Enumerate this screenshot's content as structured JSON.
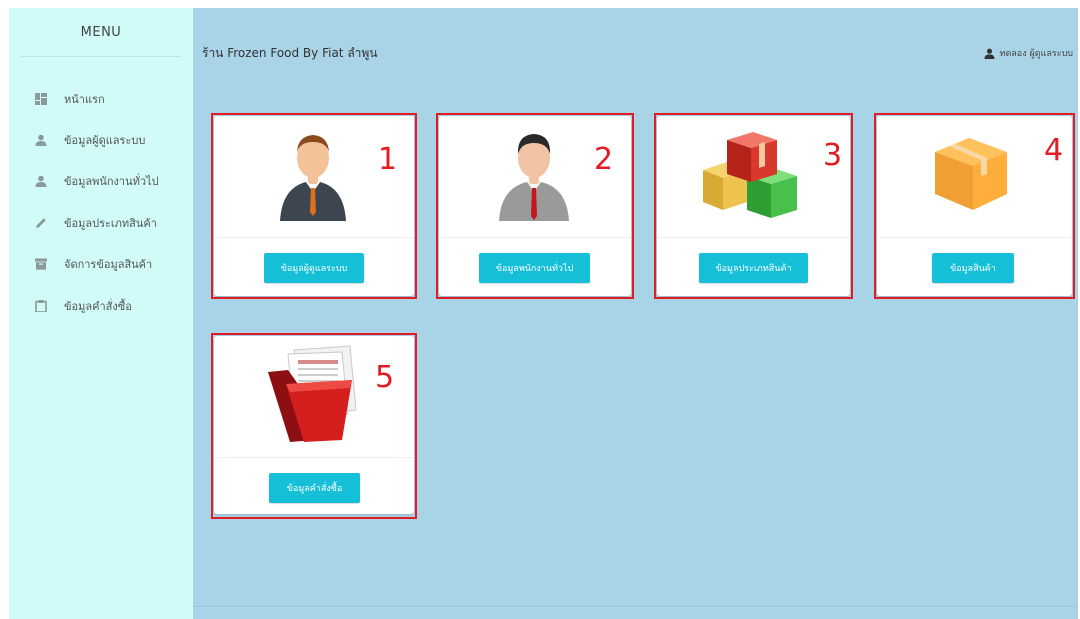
{
  "sidebar": {
    "title": "MENU",
    "items": [
      {
        "label": "หน้าแรก",
        "icon": "dashboard-icon"
      },
      {
        "label": "ข้อมูลผู้ดูแลระบบ",
        "icon": "user-icon"
      },
      {
        "label": "ข้อมูลพนักงานทั่วไป",
        "icon": "user-icon"
      },
      {
        "label": "ข้อมูลประเภทสินค้า",
        "icon": "pencil-icon"
      },
      {
        "label": "จัดการข้อมูลสินค้า",
        "icon": "archive-icon"
      },
      {
        "label": "ข้อมูลคำสั่งซื้อ",
        "icon": "clipboard-icon"
      }
    ]
  },
  "header": {
    "title": "ร้าน Frozen Food By Fiat ลำพูน",
    "user_label": "ทดลอง ผู้ดูแลระบบ"
  },
  "cards": [
    {
      "button_label": "ข้อมูลผู้ดูแลระบบ",
      "annotation": "1",
      "image": "admin-man-avatar"
    },
    {
      "button_label": "ข้อมูลพนักงานทั่วไป",
      "annotation": "2",
      "image": "employee-man-avatar"
    },
    {
      "button_label": "ข้อมูลประเภทสินค้า",
      "annotation": "3",
      "image": "colored-boxes"
    },
    {
      "button_label": "ข้อมูลสินค้า",
      "annotation": "4",
      "image": "orange-box"
    },
    {
      "button_label": "ข้อมูลคำสั่งซื้อ",
      "annotation": "5",
      "image": "red-folder"
    }
  ],
  "colors": {
    "sidebar_bg": "#d0fbf8",
    "main_bg": "#a9d3e6",
    "button_bg": "#16bfd8",
    "annotation_red": "#e31b23"
  }
}
